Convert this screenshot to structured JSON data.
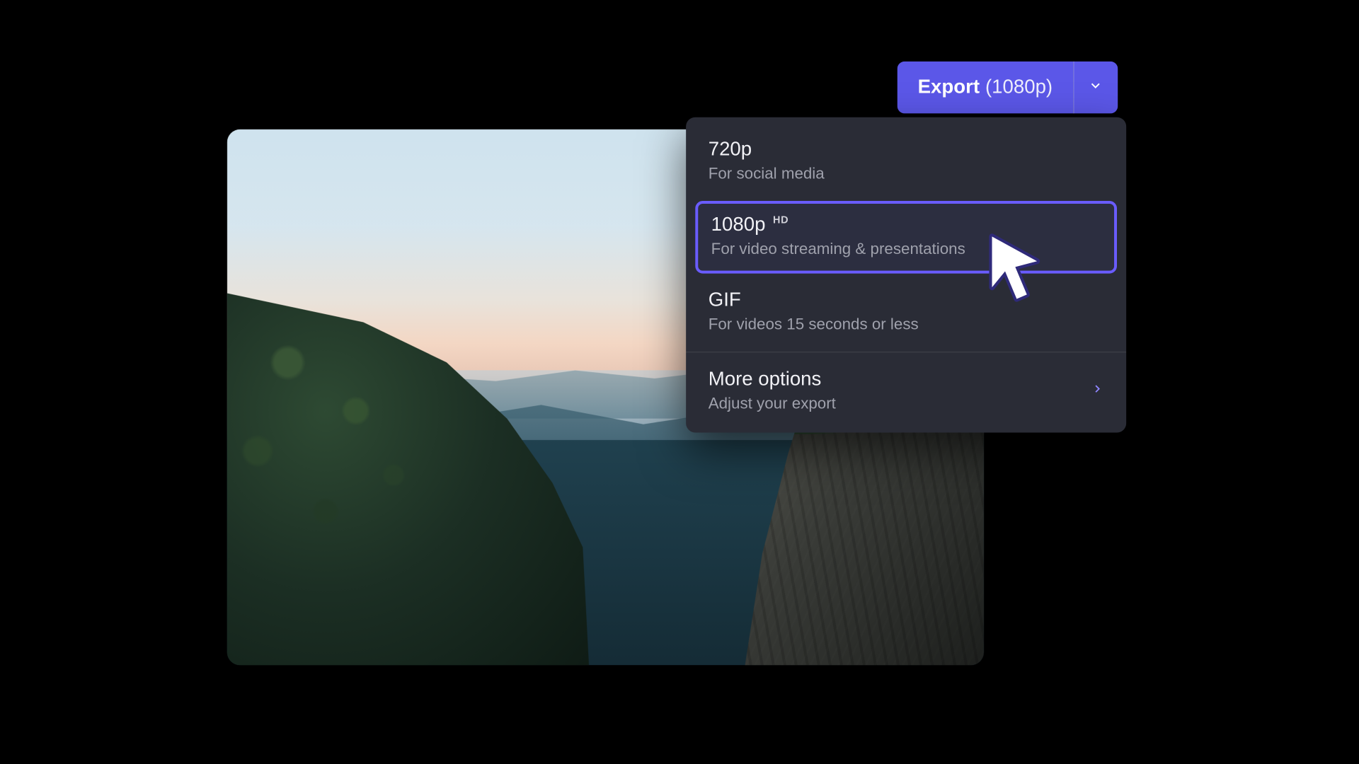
{
  "exportButton": {
    "label": "Export",
    "resolution": "(1080p)"
  },
  "menu": {
    "options": [
      {
        "title": "720p",
        "subtitle": "For social media",
        "badge": "",
        "selected": false
      },
      {
        "title": "1080p",
        "subtitle": "For video streaming & presentations",
        "badge": "HD",
        "selected": true
      },
      {
        "title": "GIF",
        "subtitle": "For videos 15 seconds or less",
        "badge": "",
        "selected": false
      }
    ],
    "more": {
      "title": "More options",
      "subtitle": "Adjust your export"
    }
  }
}
